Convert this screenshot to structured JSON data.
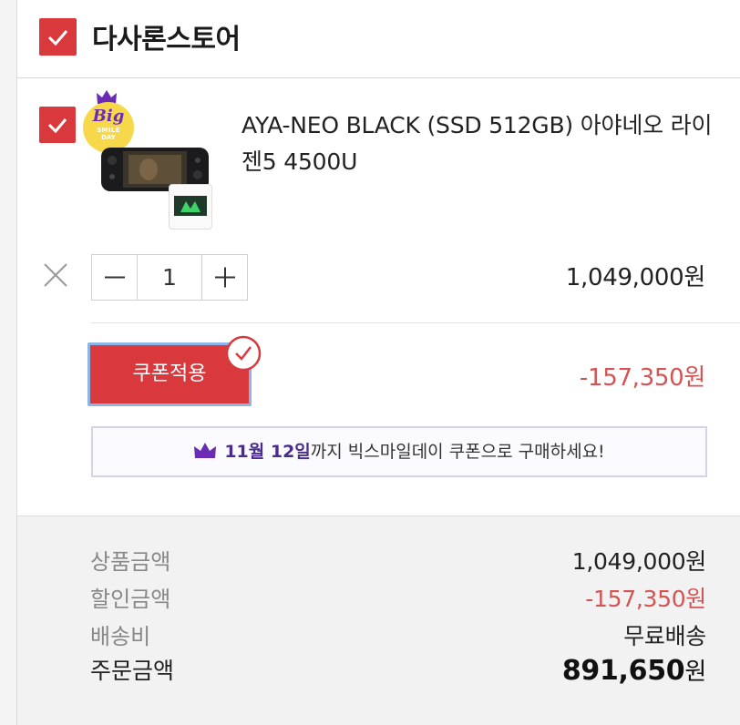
{
  "store": {
    "name": "다사론스토어",
    "checked": true
  },
  "item": {
    "checked": true,
    "badge": {
      "big": "Big",
      "smile": "SMILE",
      "day": "DAY"
    },
    "name": "AYA-NEO BLACK (SSD 512GB) 아야네오 라이젠5 4500U",
    "quantity": "1",
    "price": "1,049,000원",
    "coupon_button": "쿠폰적용",
    "discount": "-157,350원"
  },
  "promo": {
    "date": "11월 12일",
    "text": "까지 빅스마일데이 쿠폰으로 구매하세요!"
  },
  "summary": {
    "product_label": "상품금액",
    "product_value": "1,049,000원",
    "discount_label": "할인금액",
    "discount_value": "-157,350원",
    "shipping_label": "배송비",
    "shipping_value": "무료배송",
    "total_label": "주문금액",
    "total_value": "891,650",
    "total_unit": "원"
  },
  "colors": {
    "accent_red": "#d9393c",
    "discount_red": "#d45454",
    "promo_purple": "#4a2c8f",
    "badge_yellow": "#f7d84a"
  },
  "icons": [
    "check-icon",
    "crown-icon",
    "close-icon",
    "minus-icon",
    "plus-icon",
    "check-circle-icon"
  ]
}
